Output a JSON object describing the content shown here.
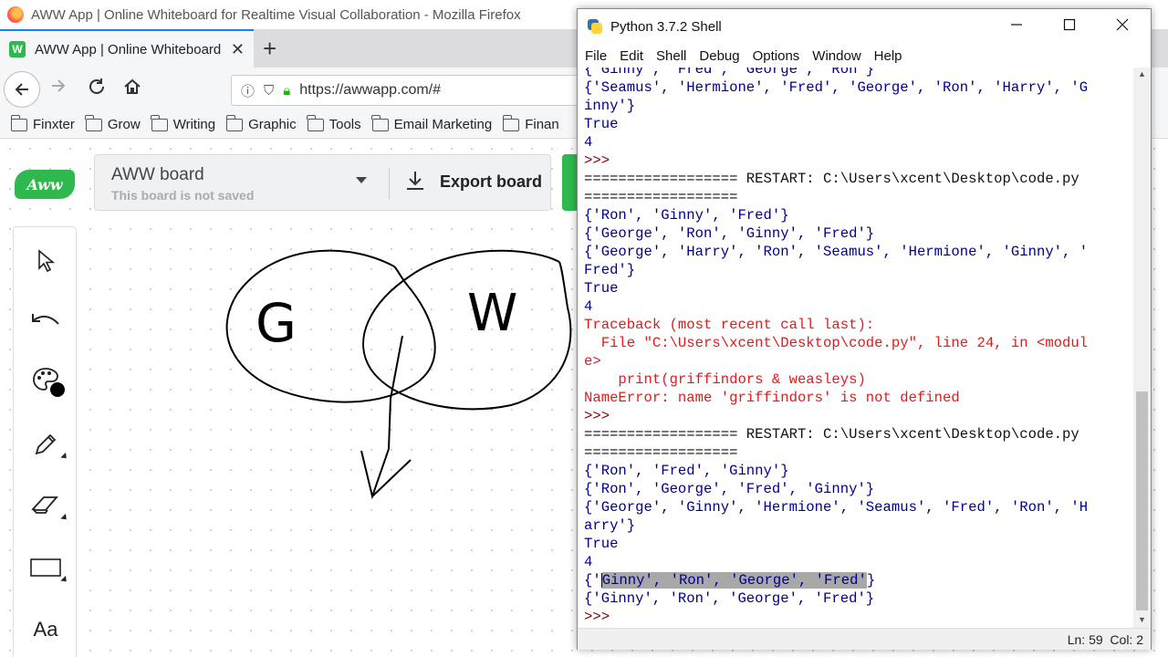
{
  "firefox": {
    "window_title": "AWW App | Online Whiteboard for Realtime Visual Collaboration - Mozilla Firefox",
    "tab_label": "AWW App | Online Whiteboard for Realtime Visual Collaboration",
    "tab_close": "✕",
    "new_tab": "+",
    "url": "https://awwapp.com/#",
    "bookmarks": [
      "Finxter",
      "Grow",
      "Writing",
      "Graphic",
      "Tools",
      "Email Marketing",
      "Finan"
    ]
  },
  "aww": {
    "logo_text": "Aww",
    "board_name": "AWW board",
    "board_status": "This board is not saved",
    "export_label": "Export board",
    "text_tool_label": "Aa",
    "drawing": {
      "left_circle_letter": "G",
      "right_circle_letter": "W"
    }
  },
  "python_shell": {
    "title": "Python 3.7.2 Shell",
    "menu": [
      "File",
      "Edit",
      "Shell",
      "Debug",
      "Options",
      "Window",
      "Help"
    ],
    "lines": [
      {
        "text": "{'Ginny', 'Fred', 'George', 'Ron'}",
        "kind": "stdout"
      },
      {
        "text": "{'Seamus', 'Hermione', 'Fred', 'George', 'Ron', 'Harry', 'G",
        "kind": "stdout"
      },
      {
        "text": "inny'}",
        "kind": "stdout"
      },
      {
        "text": "True",
        "kind": "stdout"
      },
      {
        "text": "4",
        "kind": "stdout"
      },
      {
        "text": ">>> ",
        "kind": "prompt"
      },
      {
        "text": "================== RESTART: C:\\Users\\xcent\\Desktop\\code.py",
        "kind": "restart"
      },
      {
        "text": "==================",
        "kind": "restart"
      },
      {
        "text": "{'Ron', 'Ginny', 'Fred'}",
        "kind": "stdout"
      },
      {
        "text": "{'George', 'Ron', 'Ginny', 'Fred'}",
        "kind": "stdout"
      },
      {
        "text": "{'George', 'Harry', 'Ron', 'Seamus', 'Hermione', 'Ginny', '",
        "kind": "stdout"
      },
      {
        "text": "Fred'}",
        "kind": "stdout"
      },
      {
        "text": "True",
        "kind": "stdout"
      },
      {
        "text": "4",
        "kind": "stdout"
      },
      {
        "text": "Traceback (most recent call last):",
        "kind": "error"
      },
      {
        "text": "  File \"C:\\Users\\xcent\\Desktop\\code.py\", line 24, in <modul",
        "kind": "error"
      },
      {
        "text": "e>",
        "kind": "error"
      },
      {
        "text": "    print(griffindors & weasleys)",
        "kind": "error"
      },
      {
        "text": "NameError: name 'griffindors' is not defined",
        "kind": "error"
      },
      {
        "text": ">>> ",
        "kind": "prompt"
      },
      {
        "text": "================== RESTART: C:\\Users\\xcent\\Desktop\\code.py",
        "kind": "restart"
      },
      {
        "text": "==================",
        "kind": "restart"
      },
      {
        "text": "{'Ron', 'Fred', 'Ginny'}",
        "kind": "stdout"
      },
      {
        "text": "{'Ron', 'George', 'Fred', 'Ginny'}",
        "kind": "stdout"
      },
      {
        "text": "{'George', 'Ginny', 'Hermione', 'Seamus', 'Fred', 'Ron', 'H",
        "kind": "stdout"
      },
      {
        "text": "arry'}",
        "kind": "stdout"
      },
      {
        "text": "True",
        "kind": "stdout"
      },
      {
        "text": "4",
        "kind": "stdout"
      },
      {
        "text": "{'Ginny', 'Ron', 'George', 'Fred'}",
        "kind": "selected",
        "pre": "{'",
        "sel": "Ginny', 'Ron', 'George', 'Fred'",
        "post": "}"
      },
      {
        "text": "{'Ginny', 'Ron', 'George', 'Fred'}",
        "kind": "stdout"
      },
      {
        "text": ">>> ",
        "kind": "prompt"
      }
    ],
    "status": "Ln: 59  Col: 2"
  },
  "colors": {
    "aww_green": "#2eb84d",
    "firefox_accent": "#0a84ff",
    "stdout_blue": "#00008b",
    "prompt_red": "#8b0000",
    "error_red": "#e01b1b"
  }
}
